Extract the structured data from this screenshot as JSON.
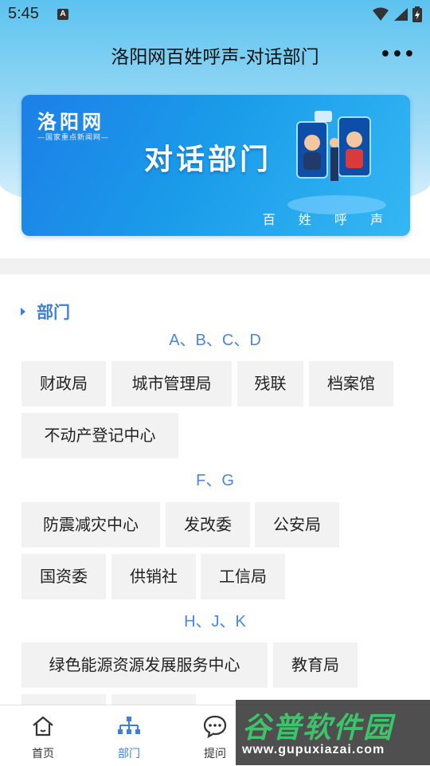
{
  "status": {
    "time": "5:45",
    "notification_icon": "a-icon"
  },
  "header": {
    "title": "洛阳网百姓呼声-对话部门",
    "more_icon": "more-icon"
  },
  "banner": {
    "logo": "洛阳网",
    "logo_sub": "—国家重点新闻网—",
    "title": "对话部门",
    "subtitle": "百 姓 呼 声"
  },
  "section": {
    "title": "部门"
  },
  "groups": [
    {
      "label": "A、B、C、D",
      "items": [
        "财政局",
        "城市管理局",
        "残联",
        "档案馆",
        "不动产登记中心"
      ]
    },
    {
      "label": "F、G",
      "items": [
        "防震减灾中心",
        "发改委",
        "公安局",
        "国资委",
        "供销社",
        "工信局"
      ]
    },
    {
      "label": "H、J、K",
      "items": [
        "绿色能源资源发展服务中心",
        "教育局"
      ]
    }
  ],
  "tabbar": {
    "tabs": [
      {
        "label": "首页",
        "icon": "home-icon"
      },
      {
        "label": "部门",
        "icon": "org-chart-icon"
      },
      {
        "label": "提问",
        "icon": "chat-icon"
      }
    ]
  },
  "watermark": {
    "main": "谷普软件园",
    "url": "www.gupuxiazai.com"
  },
  "colors": {
    "accent": "#3f7fdc",
    "chip_bg": "#f2f2f2",
    "banner": "#1d8ce8"
  }
}
